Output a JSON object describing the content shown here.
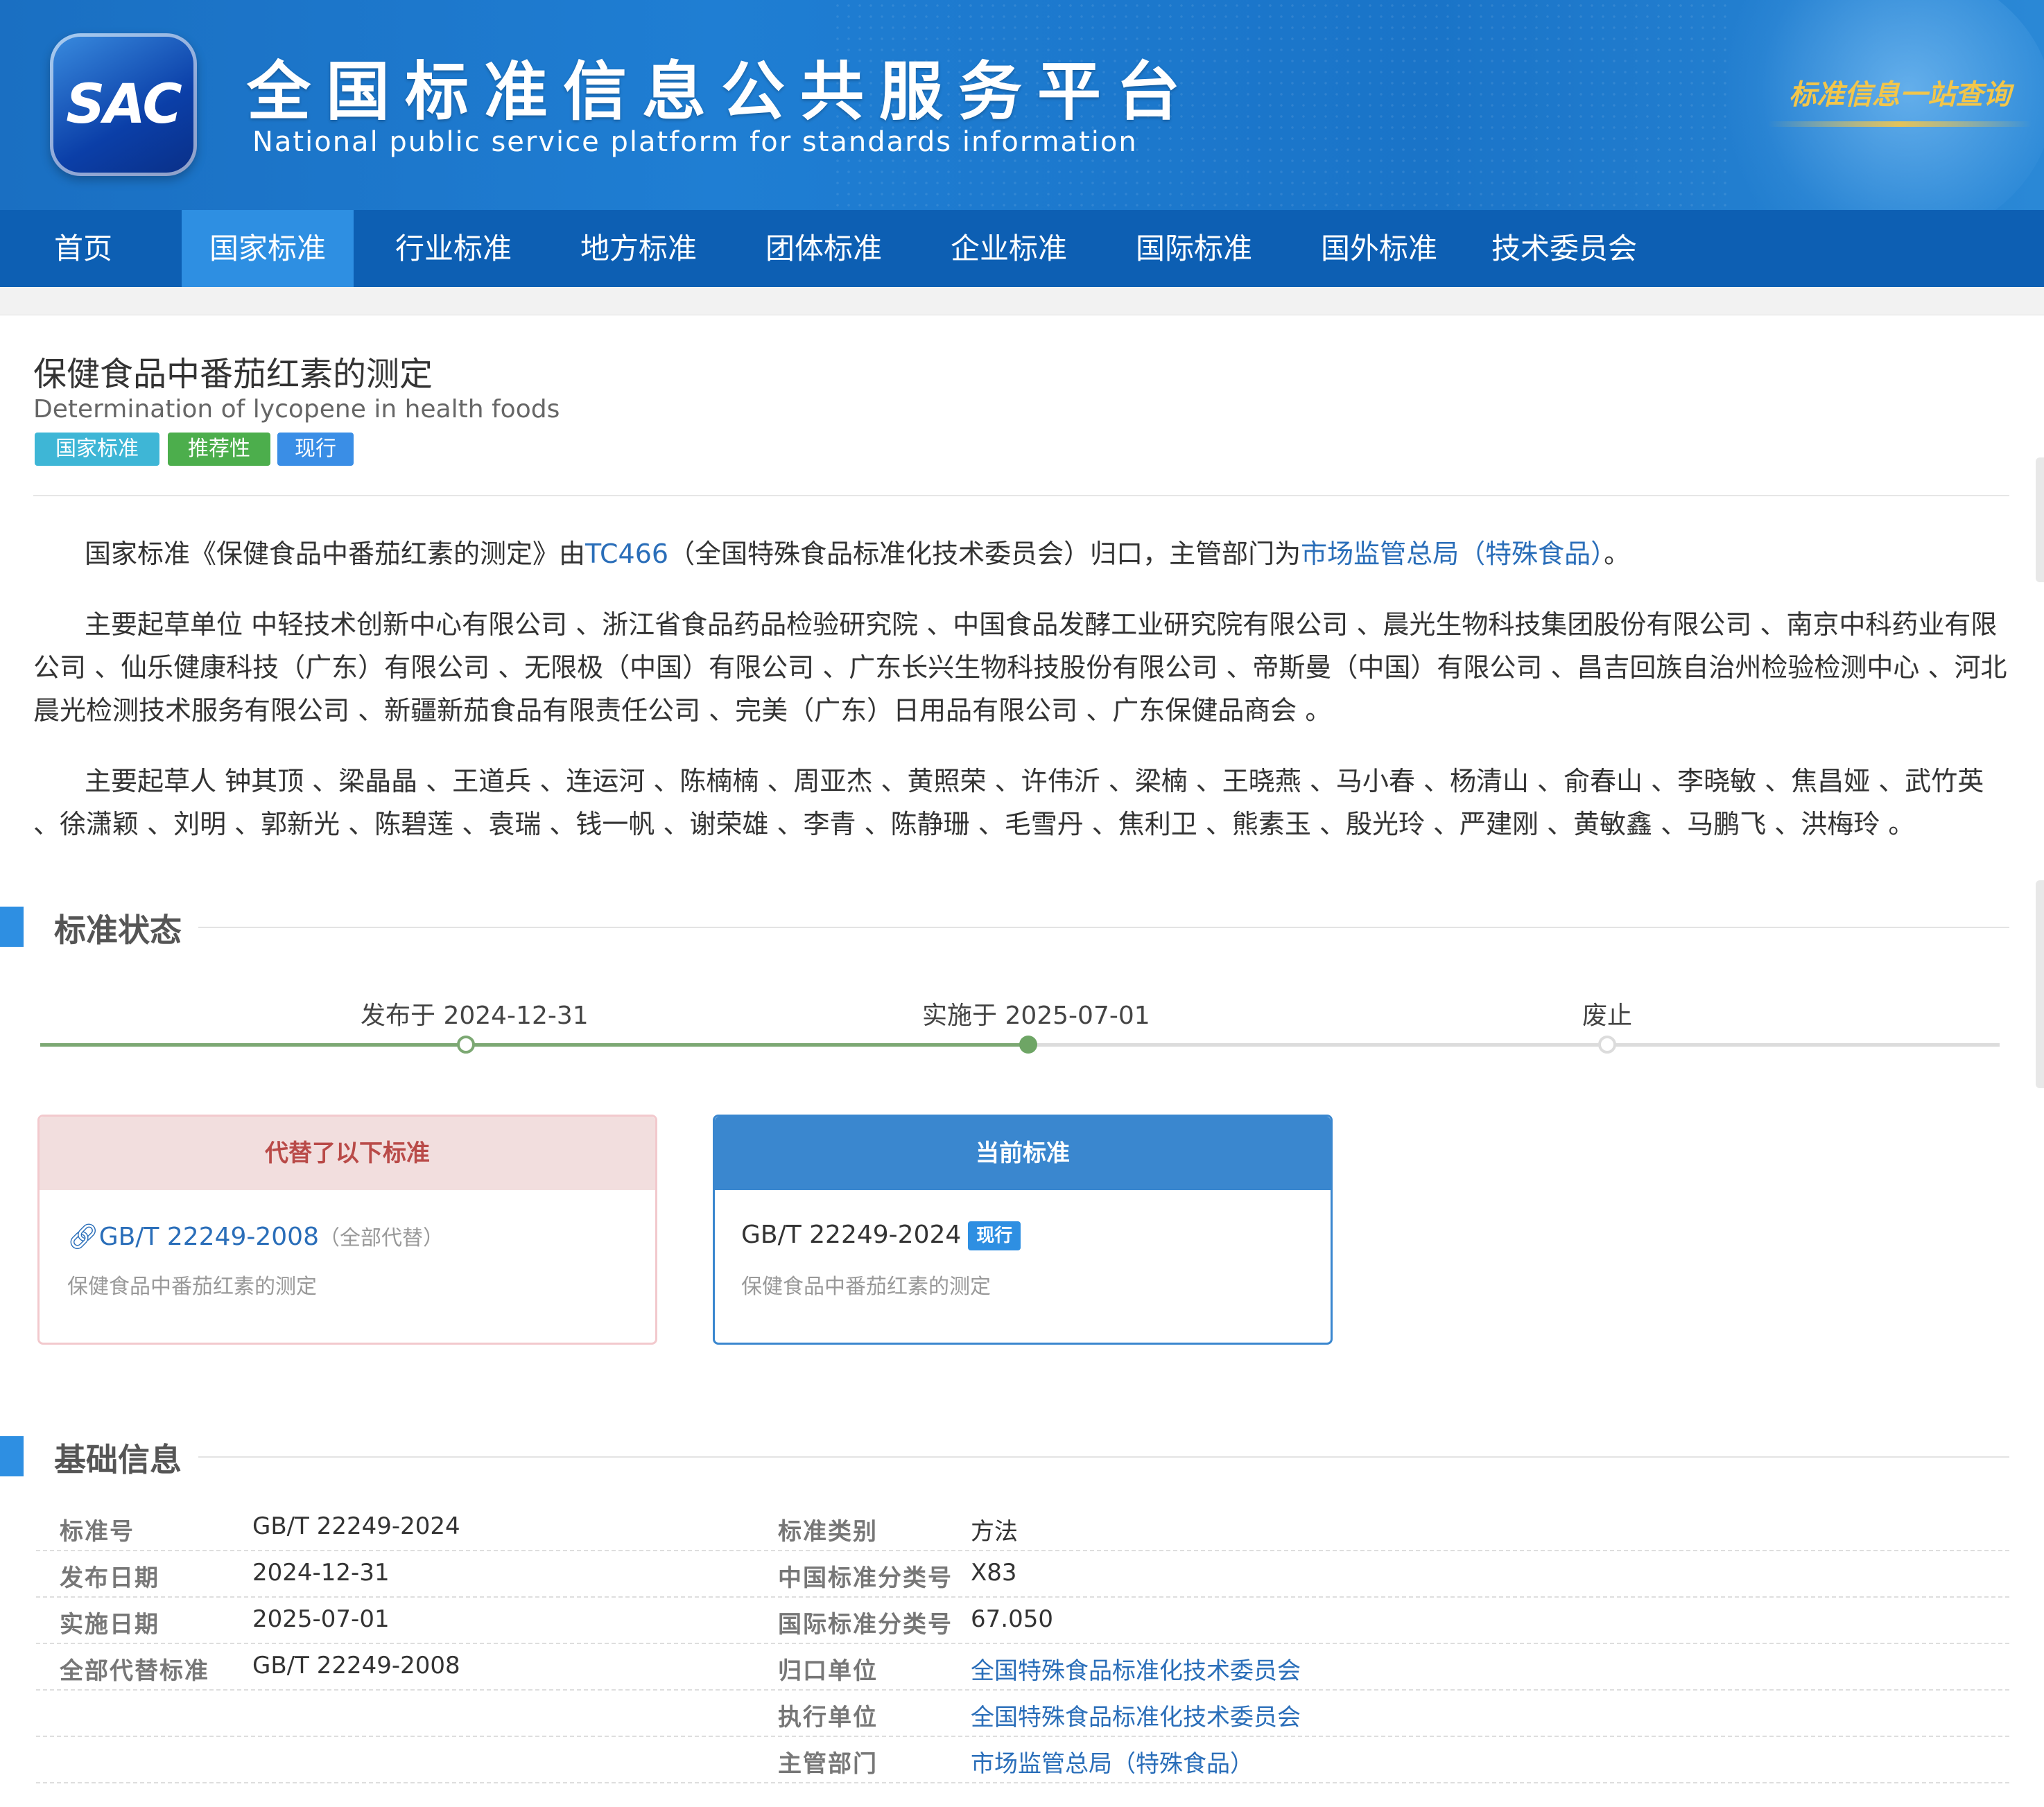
{
  "header": {
    "logo_text": "SAC",
    "title": "全国标准信息公共服务平台",
    "subtitle": "National public service platform  for standards information",
    "slogan": "标准信息一站查询"
  },
  "nav": {
    "items": [
      {
        "label": "首页",
        "active": false
      },
      {
        "label": "国家标准",
        "active": true
      },
      {
        "label": "行业标准",
        "active": false
      },
      {
        "label": "地方标准",
        "active": false
      },
      {
        "label": "团体标准",
        "active": false
      },
      {
        "label": "企业标准",
        "active": false
      },
      {
        "label": "国际标准",
        "active": false
      },
      {
        "label": "国外标准",
        "active": false
      },
      {
        "label": "技术委员会",
        "active": false
      }
    ]
  },
  "standard": {
    "title_cn": "保健食品中番茄红素的测定",
    "title_en": "Determination of lycopene in health foods",
    "tags": [
      {
        "label": "国家标准",
        "color": "#3eb6d6"
      },
      {
        "label": "推荐性",
        "color": "#4cae4c"
      },
      {
        "label": "现行",
        "color": "#3a8ee6"
      }
    ]
  },
  "intro": {
    "p1_prefix": "国家标准《保健食品中番茄红素的测定》由",
    "p1_tc": "TC466",
    "p1_mid": "（全国特殊食品标准化技术委员会）归口，主管部门为",
    "p1_dept": "市场监管总局（特殊食品）",
    "p1_suffix": "。",
    "p2": "主要起草单位 中轻技术创新中心有限公司 、浙江省食品药品检验研究院 、中国食品发酵工业研究院有限公司 、晨光生物科技集团股份有限公司 、南京中科药业有限公司 、仙乐健康科技（广东）有限公司 、无限极（中国）有限公司 、广东长兴生物科技股份有限公司 、帝斯曼（中国）有限公司 、昌吉回族自治州检验检测中心 、河北晨光检测技术服务有限公司 、新疆新茄食品有限责任公司 、完美（广东）日用品有限公司 、广东保健品商会 。",
    "p3": "主要起草人 钟其顶 、梁晶晶 、王道兵 、连运河 、陈楠楠 、周亚杰 、黄照荣 、许伟沂 、梁楠 、王晓燕 、马小春 、杨清山 、俞春山 、李晓敏 、焦昌娅 、武竹英 、徐潇颖 、刘明 、郭新光 、陈碧莲 、袁瑞 、钱一帆 、谢荣雄 、李青 、陈静珊 、毛雪丹 、焦利卫 、熊素玉 、殷光玲 、严建刚 、黄敏鑫 、马鹏飞 、洪梅玲 。"
  },
  "status_section": {
    "title": "标准状态",
    "timeline": [
      {
        "label": "发布于 2024-12-31"
      },
      {
        "label": "实施于 2025-07-01"
      },
      {
        "label": "废止"
      }
    ],
    "replaced_card": {
      "header": "代替了以下标准",
      "code": "GB/T 22249-2008",
      "note": "（全部代替）",
      "name": "保健食品中番茄红素的测定"
    },
    "current_card": {
      "header": "当前标准",
      "code": "GB/T 22249-2024",
      "badge": "现行",
      "name": "保健食品中番茄红素的测定"
    }
  },
  "basic_section": {
    "title": "基础信息",
    "rows": [
      {
        "l1": "标准号",
        "v1": "GB/T 22249-2024",
        "l2": "标准类别",
        "v2": "方法"
      },
      {
        "l1": "发布日期",
        "v1": "2024-12-31",
        "l2": "中国标准分类号",
        "v2": "X83"
      },
      {
        "l1": "实施日期",
        "v1": "2025-07-01",
        "l2": "国际标准分类号",
        "v2": "67.050"
      },
      {
        "l1": "全部代替标准",
        "v1": "GB/T 22249-2008",
        "l2": "归口单位",
        "v2": "全国特殊食品标准化技术委员会"
      },
      {
        "l1": "",
        "v1": "",
        "l2": "执行单位",
        "v2": "全国特殊食品标准化技术委员会"
      },
      {
        "l1": "",
        "v1": "",
        "l2": "主管部门",
        "v2": "市场监管总局（特殊食品）"
      }
    ]
  }
}
